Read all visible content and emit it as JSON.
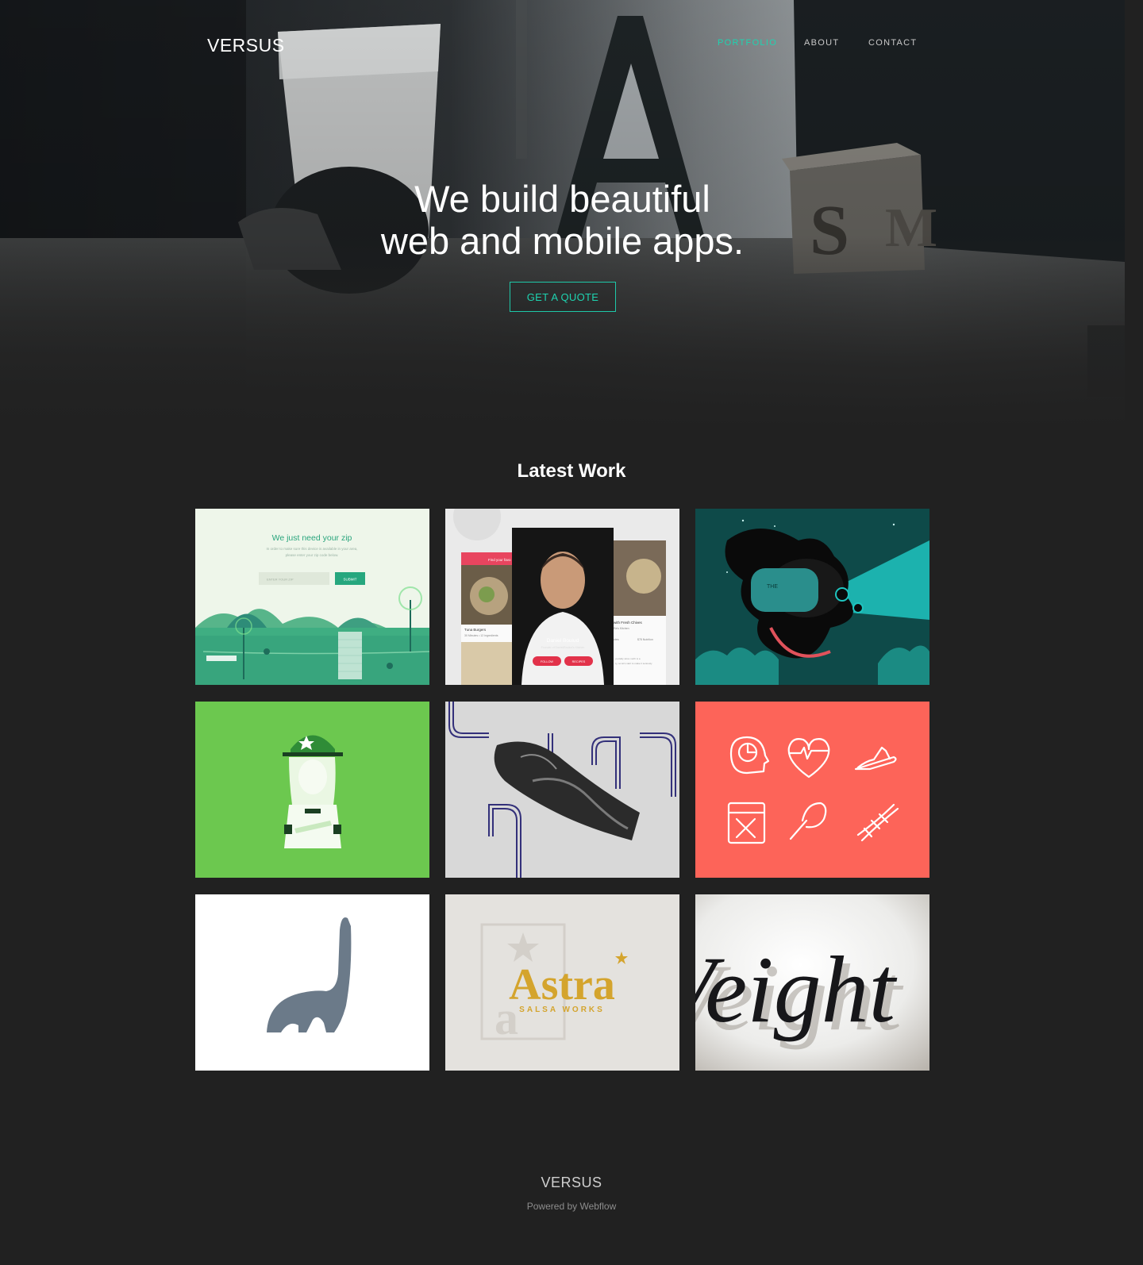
{
  "nav": {
    "brand": "VERSUS",
    "links": [
      {
        "label": "PORTFOLIO",
        "active": true
      },
      {
        "label": "ABOUT",
        "active": false
      },
      {
        "label": "CONTACT",
        "active": false
      }
    ]
  },
  "hero": {
    "title_line1": "We build beautiful",
    "title_line2": "web and mobile apps.",
    "cta": "GET A QUOTE",
    "backdrop_letters": {
      "big": "A",
      "block_front": "S",
      "block_side": "M"
    }
  },
  "latest_work": {
    "heading": "Latest Work",
    "items": [
      {
        "name": "zip-landing",
        "heading": "We just need your zip",
        "line1": "In order to make sure this device is available in your area,",
        "line2": "please enter your zip code below.",
        "placeholder": "ENTER YOUR ZIP",
        "button": "SUBMIT"
      },
      {
        "name": "chef-app",
        "left_header": "Find your favo",
        "left_caption": "Tuna Burgers",
        "left_meta": "30 Minutes   • 12 Ingredients",
        "chef_name": "Daniel Boulud",
        "chef_title": "Founder of Daniel/Boulud's Kitchen",
        "follow": "FOLLOW",
        "recipes": "RECIPES",
        "right_caption": "with Fresh Chives",
        "right_sub": "Ra's Kitchen",
        "right_meta1": "utes",
        "right_meta2": "$78 Nutrition",
        "right_text1": "...pecially since north is a",
        "right_text2": "...ly, so let's start to make it seriously"
      },
      {
        "name": "octopus-submarine-illustration",
        "hull_text": "THE"
      },
      {
        "name": "baseball-girl-illustration"
      },
      {
        "name": "handshake-typography"
      },
      {
        "name": "health-icons-set"
      },
      {
        "name": "elephant-logo"
      },
      {
        "name": "astra-logo",
        "title": "Astra",
        "subtitle": "SALSA WORKS",
        "bg_letter": "a"
      },
      {
        "name": "script-lettering",
        "text": "Veight"
      }
    ]
  },
  "footer": {
    "brand": "VERSUS",
    "powered": "Powered by Webflow"
  },
  "colors": {
    "accent": "#1ed3b0",
    "page_bg": "#212121",
    "tile_green": "#6cc84f",
    "tile_coral": "#fd6459",
    "tile_teal": "#0d4d4a"
  }
}
